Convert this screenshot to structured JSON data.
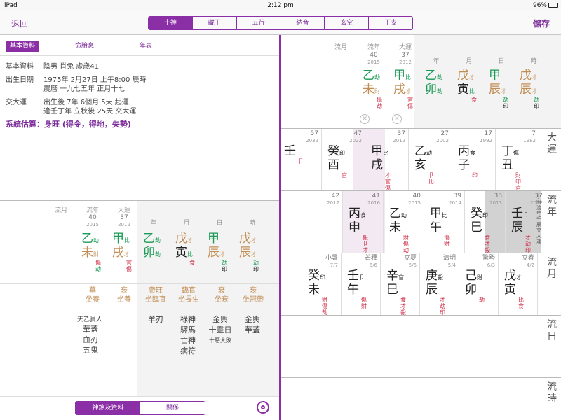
{
  "status_bar": {
    "carrier": "iPad",
    "time": "2:12 pm",
    "battery": "96%"
  },
  "nav": {
    "back": "返回",
    "save": "儲存",
    "segments": [
      "十神",
      "藏干",
      "五行",
      "納音",
      "玄空",
      "干支"
    ],
    "active": 0
  },
  "left_tabs": [
    "基本資料",
    "命胎息",
    "年表"
  ],
  "basic": {
    "label1": "基本資料",
    "value1": "陰男 肖兔 虛歲41",
    "label2": "出生日期",
    "value2a": "1975年 2月27日 上午8:00 辰時",
    "value2b": "農曆 一九七五年 正月十七",
    "label3": "交大運",
    "value3a": "出生後 7年 6個月 5天 起運",
    "value3b": "逢壬丁年 立秋後 25天 交大運",
    "estimate": "系統估算：身旺 (得令，得地，失勢)"
  },
  "chart_heads": {
    "flow_month": "流月",
    "flow_year": "流年",
    "big_luck": "大運",
    "year": "年",
    "month": "月",
    "day": "日",
    "hour": "時"
  },
  "flow_year_num": "40",
  "flow_year_y": "2015",
  "luck_num": "37",
  "luck_y": "2012",
  "pillars": {
    "fy": {
      "stem": "乙",
      "stem_god": "劫",
      "branch": "未",
      "b1": "財",
      "b2": "傷",
      "b3": "劫"
    },
    "lk": {
      "stem": "甲",
      "stem_god": "比",
      "branch": "戌",
      "b1": "才",
      "b2": "官",
      "b3": "傷"
    },
    "yr": {
      "stem": "乙",
      "stem_god": "劫",
      "branch": "卯",
      "b1": "劫"
    },
    "mo": {
      "stem": "戊",
      "stem_god": "才",
      "branch": "寅",
      "b1": "比",
      "b2": "食"
    },
    "dy": {
      "stem": "甲",
      "stem_god": "",
      "branch": "辰",
      "b1": "才",
      "b2": "劫",
      "b3": "印"
    },
    "hr": {
      "stem": "戊",
      "stem_god": "才",
      "branch": "辰",
      "b1": "才",
      "b2": "劫",
      "b3": "印"
    }
  },
  "twelve": [
    {
      "a": "墓",
      "b": "坐養"
    },
    {
      "a": "衰",
      "b": "坐養"
    },
    {
      "a": "帝旺",
      "b": "坐臨官"
    },
    {
      "a": "臨官",
      "b": "坐長生"
    },
    {
      "a": "衰",
      "b": "坐衰"
    },
    {
      "a": "衰",
      "b": "坐冠帶"
    }
  ],
  "shensha": {
    "c1": [
      "天乙貴人",
      "華蓋",
      "血刃",
      "五鬼"
    ],
    "c3": [
      "羊刃"
    ],
    "c4": [
      "祿神",
      "驛馬",
      "亡神",
      "病符"
    ],
    "c5": [
      "金輿",
      "十靈日",
      "十惡大敗"
    ],
    "c6": [
      "金輿",
      "華蓋"
    ]
  },
  "bottom_tabs": [
    "神煞及資料",
    "關係"
  ],
  "side_labels": {
    "luck": "大運",
    "year": "流年",
    "month": "流月",
    "day": "流日",
    "hour": "流時"
  },
  "luck_cycles": [
    {
      "num": "57",
      "y": "2032",
      "stem": "壬",
      "sg": "",
      "branch": "",
      "g": "卩"
    },
    {
      "num": "47",
      "y": "2022",
      "stem": "癸",
      "sg": "印",
      "branch": "酉",
      "g": "官"
    },
    {
      "num": "37",
      "y": "2012",
      "stem": "甲",
      "sg": "比",
      "branch": "戌",
      "g": "才 官 傷"
    },
    {
      "num": "27",
      "y": "2002",
      "stem": "乙",
      "sg": "劫",
      "branch": "亥",
      "g": "卩 比"
    },
    {
      "num": "17",
      "y": "1992",
      "stem": "丙",
      "sg": "食",
      "branch": "子",
      "g": "印"
    },
    {
      "num": "7",
      "y": "1982",
      "stem": "丁",
      "sg": "傷",
      "branch": "丑",
      "g": "財 印 官"
    }
  ],
  "year_cycles": [
    {
      "num": "42",
      "y": "2017",
      "stem": "",
      "sg": "",
      "branch": ""
    },
    {
      "num": "41",
      "y": "2016",
      "stem": "丙",
      "sg": "食",
      "branch": "申",
      "g": "殺 卩 才"
    },
    {
      "num": "40",
      "y": "2015",
      "stem": "乙",
      "sg": "劫",
      "branch": "未",
      "g": "財 傷 劫"
    },
    {
      "num": "39",
      "y": "2014",
      "stem": "甲",
      "sg": "比",
      "branch": "午",
      "g": "傷 財"
    },
    {
      "num": "38",
      "y": "2013",
      "stem": "癸",
      "sg": "印",
      "branch": "巳",
      "g": "食 才 殺"
    },
    {
      "num": "37",
      "y": "2012",
      "stem": "壬",
      "sg": "卩",
      "branch": "辰",
      "g": "才 劫 印",
      "note": "小限 流年 壬辰 交大運"
    }
  ],
  "month_cycles": [
    {
      "term": "小暑",
      "d": "7/7",
      "stem": "癸",
      "sg": "印",
      "branch": "未",
      "g": "財 傷 劫"
    },
    {
      "term": "芒種",
      "d": "6/6",
      "stem": "壬",
      "sg": "卩",
      "branch": "午",
      "g": "傷 財"
    },
    {
      "term": "立夏",
      "d": "5/6",
      "stem": "辛",
      "sg": "官",
      "branch": "巳",
      "g": "食 才 殺"
    },
    {
      "term": "清明",
      "d": "5/4",
      "stem": "庚",
      "sg": "殺",
      "branch": "辰",
      "g": "才 劫 印"
    },
    {
      "term": "驚蟄",
      "d": "6/3",
      "stem": "己",
      "sg": "財",
      "branch": "卯",
      "g": "劫"
    },
    {
      "term": "立春",
      "d": "4/2",
      "stem": "戊",
      "sg": "才",
      "branch": "寅",
      "g": "比 食"
    }
  ]
}
